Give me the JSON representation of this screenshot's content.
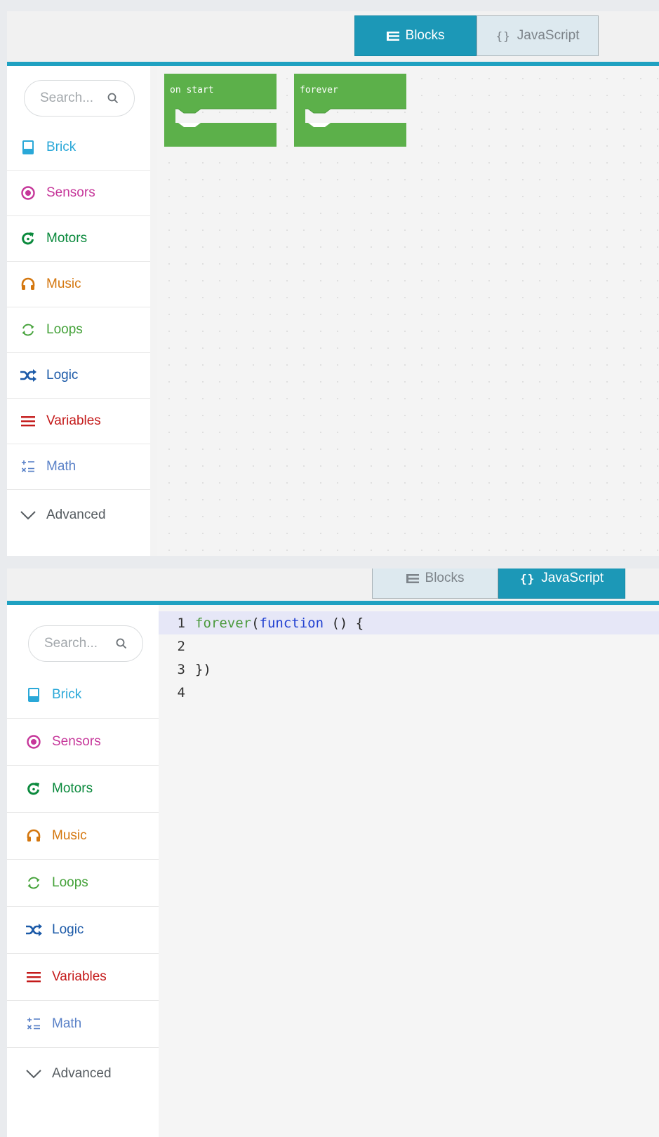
{
  "toggle": {
    "blocks_label": "Blocks",
    "javascript_label": "JavaScript",
    "javascript_icon_text": "{}"
  },
  "search": {
    "placeholder": "Search..."
  },
  "categories": [
    {
      "id": "brick",
      "label": "Brick",
      "color": "#2aa8d8",
      "icon": "brick-icon"
    },
    {
      "id": "sensors",
      "label": "Sensors",
      "color": "#c6379a",
      "icon": "sensors-icon"
    },
    {
      "id": "motors",
      "label": "Motors",
      "color": "#0b8a3d",
      "icon": "motors-icon"
    },
    {
      "id": "music",
      "label": "Music",
      "color": "#d4770f",
      "icon": "music-icon"
    },
    {
      "id": "loops",
      "label": "Loops",
      "color": "#45a23a",
      "icon": "loops-icon"
    },
    {
      "id": "logic",
      "label": "Logic",
      "color": "#1c5aa8",
      "icon": "logic-icon"
    },
    {
      "id": "variables",
      "label": "Variables",
      "color": "#c41a1a",
      "icon": "variables-icon"
    },
    {
      "id": "math",
      "label": "Math",
      "color": "#5b82c8",
      "icon": "math-icon"
    },
    {
      "id": "advanced",
      "label": "Advanced",
      "color": "#555b60",
      "icon": "chevron-down-icon"
    }
  ],
  "workspace": {
    "blocks": [
      {
        "label": "on start",
        "color": "#5cb04a"
      },
      {
        "label": "forever",
        "color": "#5cb04a"
      }
    ]
  },
  "editor": {
    "line_numbers": [
      "1",
      "2",
      "3",
      "4"
    ],
    "current_line": 1,
    "line1": {
      "fn": "forever",
      "open": "(",
      "kw": "function",
      "rest": " () {"
    },
    "line2": "",
    "line3": "})",
    "line4": ""
  },
  "colors": {
    "accent": "#1fa1c1",
    "block_green": "#5cb04a",
    "active_tab": "#1c98b7"
  }
}
